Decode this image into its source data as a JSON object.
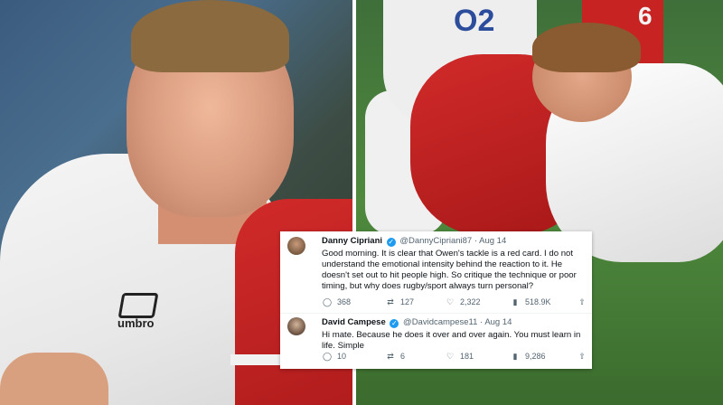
{
  "photos": {
    "left_logo_text": "umbro",
    "right_sponsor_text": "O2",
    "right_jersey_number": "6"
  },
  "tweets": [
    {
      "name": "Danny Cipriani",
      "verified": true,
      "handle": "@DannyCipriani87",
      "date": "Aug 14",
      "text": "Good morning. It is clear that Owen's tackle is a red card. I do not understand the emotional intensity behind the reaction to it. He doesn't set out to hit people high. So critique the technique or poor timing, but why does rugby/sport always turn personal?",
      "replies": "368",
      "retweets": "127",
      "likes": "2,322",
      "views": "518.9K"
    },
    {
      "name": "David Campese",
      "verified": true,
      "handle": "@Davidcampese11",
      "date": "Aug 14",
      "text": "Hi mate. Because he does it over and over again. You must learn in life. Simple",
      "replies": "10",
      "retweets": "6",
      "likes": "181",
      "views": "9,286"
    }
  ],
  "icons": {
    "reply": "reply-icon",
    "retweet": "retweet-icon",
    "like": "heart-icon",
    "views": "views-icon",
    "share": "share-icon"
  },
  "colors": {
    "verified": "#1d9bf0",
    "text": "#0f1419",
    "muted": "#536471"
  }
}
